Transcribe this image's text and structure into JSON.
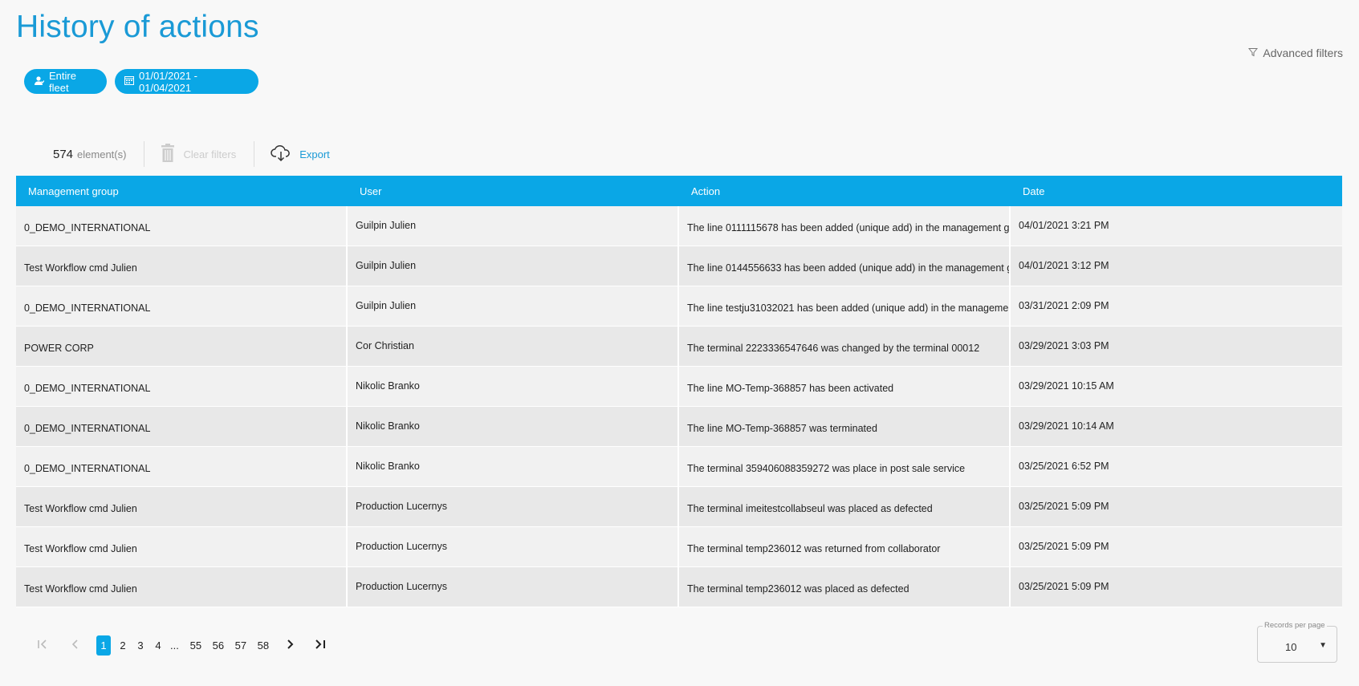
{
  "page": {
    "title": "History of actions"
  },
  "filters": {
    "advanced_label": "Advanced filters",
    "fleet_chip": "Entire fleet",
    "date_chip": "01/01/2021 - 01/04/2021"
  },
  "toolbar": {
    "count": "574",
    "count_label": "element(s)",
    "clear_filters": "Clear filters",
    "export": "Export"
  },
  "table": {
    "headers": [
      "Management group",
      "User",
      "Action",
      "Date"
    ],
    "rows": [
      [
        "0_DEMO_INTERNATIONAL",
        "Guilpin Julien",
        "The line 0111115678 has been added (unique add) in the management g",
        "04/01/2021 3:21 PM"
      ],
      [
        "Test Workflow cmd Julien",
        "Guilpin Julien",
        "The line 0144556633 has been added (unique add) in the management g",
        "04/01/2021 3:12 PM"
      ],
      [
        "0_DEMO_INTERNATIONAL",
        "Guilpin Julien",
        "The line testju31032021 has been added (unique add) in the manageme",
        "03/31/2021 2:09 PM"
      ],
      [
        "POWER CORP",
        "Cor Christian",
        "The terminal 2223336547646 was changed by the terminal 00012",
        "03/29/2021 3:03 PM"
      ],
      [
        "0_DEMO_INTERNATIONAL",
        "Nikolic Branko",
        "The line MO-Temp-368857 has been activated",
        "03/29/2021 10:15 AM"
      ],
      [
        "0_DEMO_INTERNATIONAL",
        "Nikolic Branko",
        "The line MO-Temp-368857 was terminated",
        "03/29/2021 10:14 AM"
      ],
      [
        "0_DEMO_INTERNATIONAL",
        "Nikolic Branko",
        "The terminal 359406088359272 was place in post sale service",
        "03/25/2021 6:52 PM"
      ],
      [
        "Test Workflow cmd Julien",
        "Production Lucernys",
        "The terminal imeitestcollabseul was placed as defected",
        "03/25/2021 5:09 PM"
      ],
      [
        "Test Workflow cmd Julien",
        "Production Lucernys",
        "The terminal temp236012 was returned from collaborator",
        "03/25/2021 5:09 PM"
      ],
      [
        "Test Workflow cmd Julien",
        "Production Lucernys",
        "The terminal temp236012 was placed as defected",
        "03/25/2021 5:09 PM"
      ]
    ]
  },
  "pagination": {
    "pages": [
      "1",
      "2",
      "3",
      "4"
    ],
    "ellipsis": "...",
    "last_pages": [
      "55",
      "56",
      "57",
      "58"
    ],
    "active": "1"
  },
  "records_per_page": {
    "label": "Records per page",
    "value": "10"
  },
  "colors": {
    "accent": "#0aa7e6",
    "title": "#1a9ad6"
  },
  "icons": [
    "filter-icon",
    "user-group-icon",
    "calendar-icon",
    "trash-icon",
    "cloud-download-icon",
    "first-page-icon",
    "prev-page-icon",
    "next-page-icon",
    "last-page-icon",
    "caret-down-icon"
  ]
}
